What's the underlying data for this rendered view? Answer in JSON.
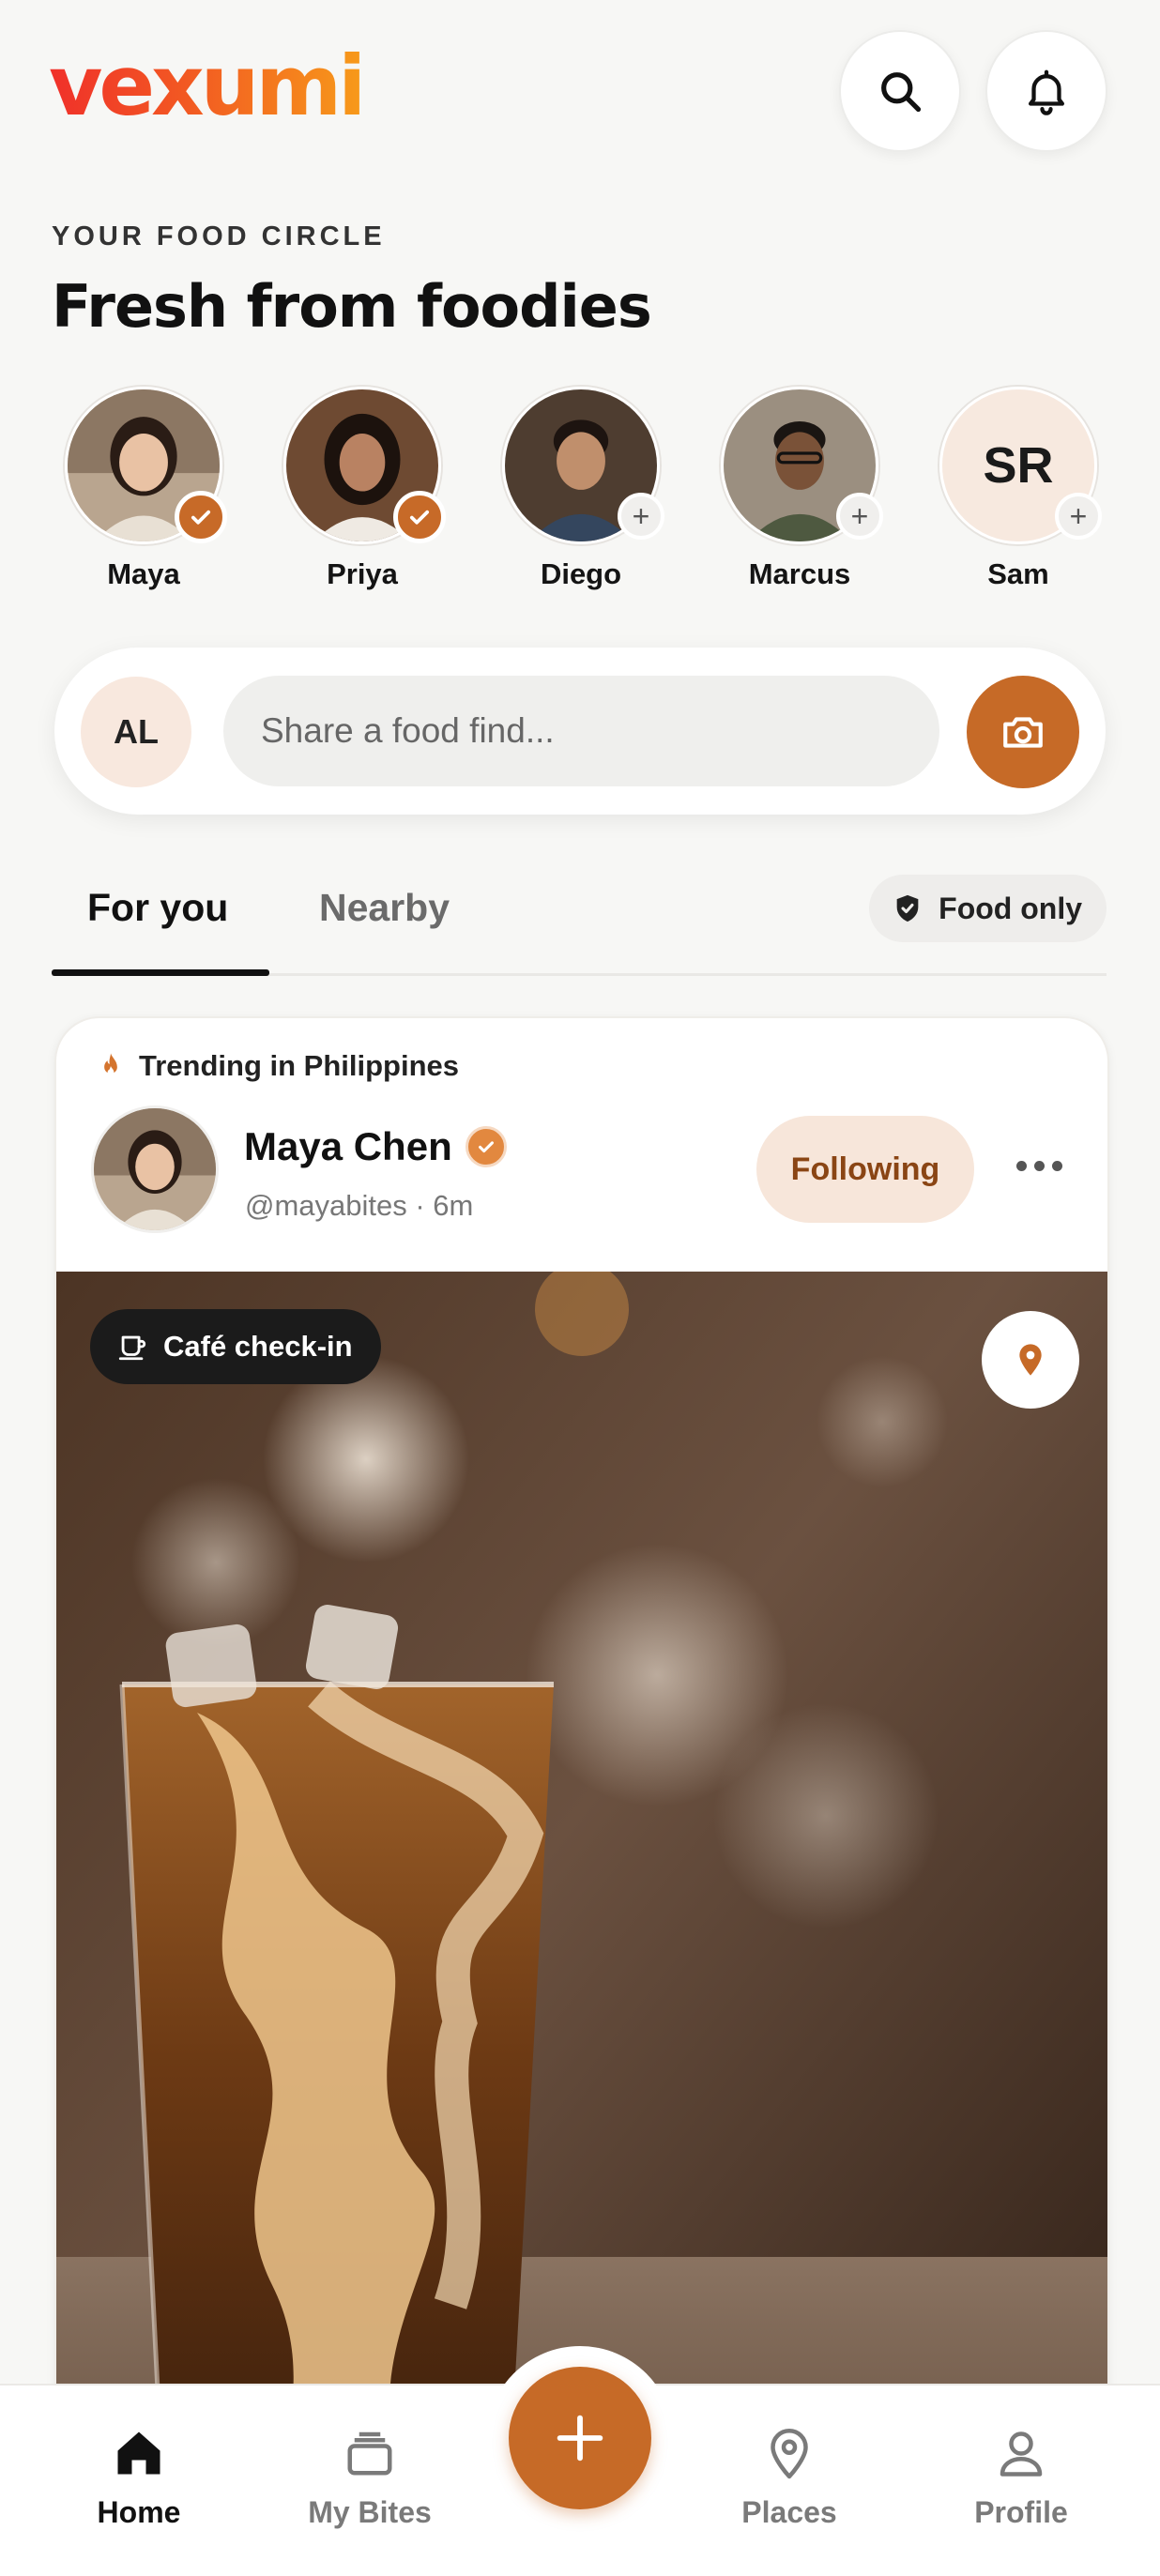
{
  "app": {
    "logo": "vexumi",
    "accent": "#c66a27"
  },
  "header": {
    "eyebrow": "YOUR FOOD CIRCLE",
    "title": "Fresh from foodies",
    "search_icon": "search-icon",
    "notifications_icon": "bell-icon"
  },
  "stories": [
    {
      "name": "Maya",
      "status": "following"
    },
    {
      "name": "Priya",
      "status": "following"
    },
    {
      "name": "Diego",
      "status": "follow"
    },
    {
      "name": "Marcus",
      "status": "follow"
    },
    {
      "name": "Sam",
      "status": "follow",
      "initials": "SR"
    }
  ],
  "composer": {
    "user_initials": "AL",
    "placeholder": "Share a food find...",
    "camera_icon": "camera-icon"
  },
  "tabs": [
    {
      "label": "For you",
      "active": true
    },
    {
      "label": "Nearby",
      "active": false
    }
  ],
  "filter": {
    "label": "Food only",
    "icon": "shield-icon"
  },
  "post": {
    "trending": "Trending in Philippines",
    "author": "Maya Chen",
    "handle": "@mayabites · 6m",
    "follow_label": "Following",
    "tag": "Café check-in",
    "more_icon": "more-icon",
    "location_icon": "location-pin-icon"
  },
  "nav": [
    {
      "label": "Home",
      "icon": "home-icon",
      "active": true
    },
    {
      "label": "My Bites",
      "icon": "stack-icon",
      "active": false
    },
    {
      "label": "Places",
      "icon": "location-pin-icon",
      "active": false
    },
    {
      "label": "Profile",
      "icon": "profile-icon",
      "active": false
    }
  ]
}
